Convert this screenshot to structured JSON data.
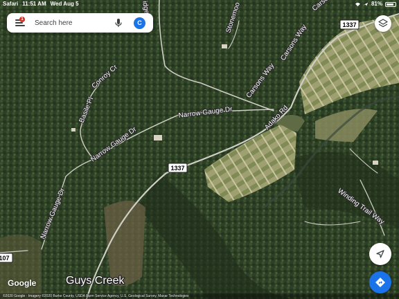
{
  "status_bar": {
    "app": "Safari",
    "time": "11:51 AM",
    "date": "Wed Aug 5",
    "battery": "81%",
    "battery_level": 0.81
  },
  "search": {
    "placeholder": "Search here",
    "notification_count": "1",
    "avatar_letter": "C"
  },
  "map": {
    "roads": [
      {
        "name": "Stonemoo",
        "id": "stonemoo"
      },
      {
        "name": "Conroy Cr",
        "id": "conroy"
      },
      {
        "name": "Basile Pl",
        "id": "basile"
      },
      {
        "name": "Narrow Gauge Dr",
        "id": "narrow-gauge-1"
      },
      {
        "name": "Narrow Gauge Dr",
        "id": "narrow-gauge-2"
      },
      {
        "name": "Narrow Gauge Dr",
        "id": "narrow-gauge-3"
      },
      {
        "name": "Carsons Way",
        "id": "carsons-1"
      },
      {
        "name": "Carsons Way",
        "id": "carsons-2"
      },
      {
        "name": "Carso",
        "id": "carsons-3"
      },
      {
        "name": "Adako Rd",
        "id": "adako"
      },
      {
        "name": "Winding Trail Way",
        "id": "winding-trail"
      },
      {
        "name": "idge",
        "id": "ridge"
      }
    ],
    "route_shields": [
      {
        "id": "shield-1337-top",
        "number": "1337"
      },
      {
        "id": "shield-1337-mid",
        "number": "1337"
      },
      {
        "id": "shield-107",
        "number": "107"
      }
    ],
    "places": [
      {
        "name": "Guys Creek"
      }
    ]
  },
  "branding": {
    "logo": "Google",
    "attribution": "©2020 Google · Imagery ©2020 Burke County, USDA Farm Service Agency, U.S. Geological Survey, Maxar Technologies"
  },
  "colors": {
    "accent": "#1a73e8",
    "badge": "#d93025"
  }
}
